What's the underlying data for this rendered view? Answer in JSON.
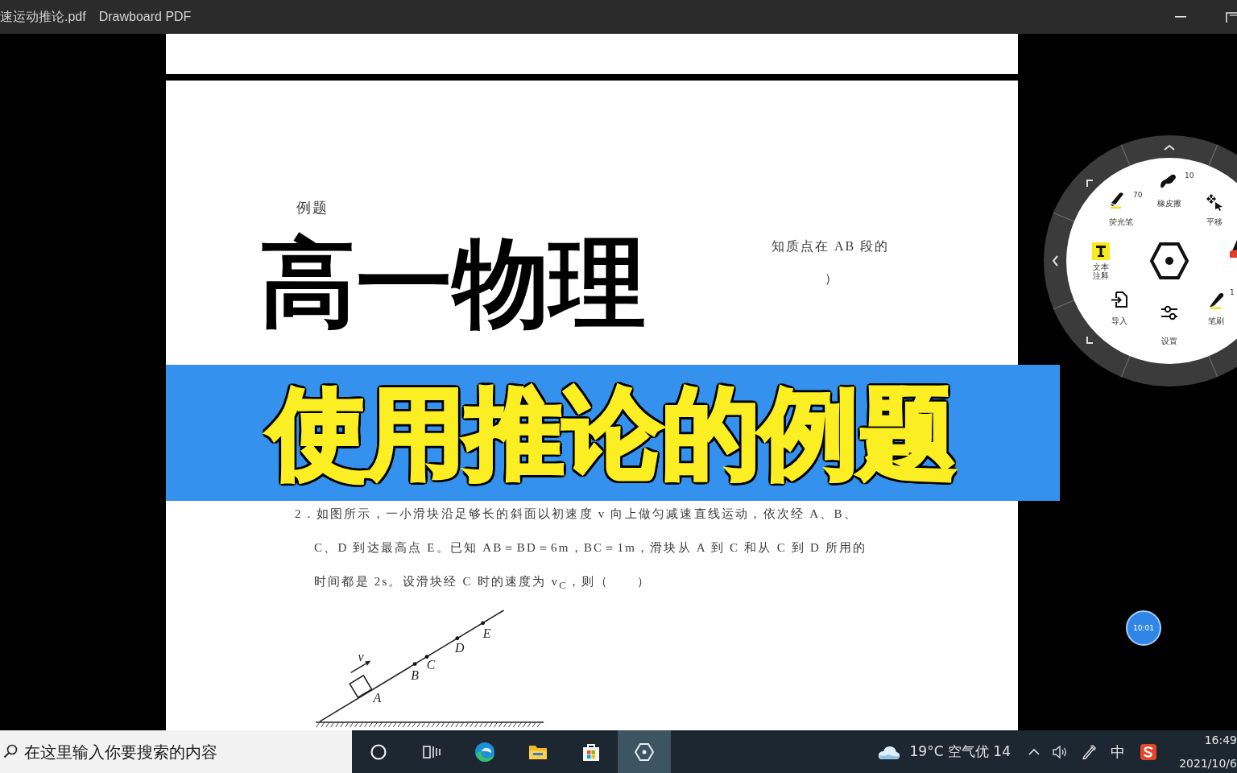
{
  "window": {
    "title": "速运动推论.pdf",
    "app_name": "Drawboard PDF"
  },
  "document": {
    "heading": "例题",
    "partial_lines": [
      "知质点在 AB 段的",
      "）"
    ],
    "problem_lines": [
      "2．如图所示，一小滑块沿足够长的斜面以初速度 v 向上做匀减速直线运动，依次经 A、B、",
      "C、D 到达最高点 E。已知 AB＝BD＝6m，BC＝1m，滑块从 A 到 C 和从 C 到 D 所用的",
      "时间都是 2s。设滑块经 C 时的速度为 v$_{C}$，则（　　）"
    ],
    "diagram": {
      "velocity_label": "v",
      "points": [
        "A",
        "B",
        "C",
        "D",
        "E"
      ]
    }
  },
  "overlay": {
    "title": "高一物理",
    "banner": "使用推论的例题"
  },
  "tool_wheel": {
    "items": [
      {
        "kind": "highlighter",
        "label": "荧光笔",
        "value": "70"
      },
      {
        "kind": "eraser",
        "label": "橡皮擦",
        "value": "10"
      },
      {
        "kind": "pan",
        "label": "平移"
      },
      {
        "kind": "text",
        "label": "文本注释"
      },
      {
        "kind": "import",
        "label": "导入"
      },
      {
        "kind": "settings",
        "label": "设置"
      },
      {
        "kind": "pen",
        "label": "笔刷",
        "value": "1"
      }
    ]
  },
  "timer": {
    "label": "10:01"
  },
  "taskbar": {
    "search_placeholder": "在这里输入你要搜索的内容",
    "apps": [
      {
        "kind": "cortana",
        "selected": false
      },
      {
        "kind": "task_view",
        "selected": false
      },
      {
        "kind": "edge",
        "selected": false
      },
      {
        "kind": "files",
        "selected": false
      },
      {
        "kind": "store",
        "selected": false
      },
      {
        "kind": "drawboard",
        "selected": true
      }
    ],
    "weather": "19°C 空气优 14",
    "input_method": "中",
    "time": "16:49",
    "date": "2021/10/6"
  }
}
